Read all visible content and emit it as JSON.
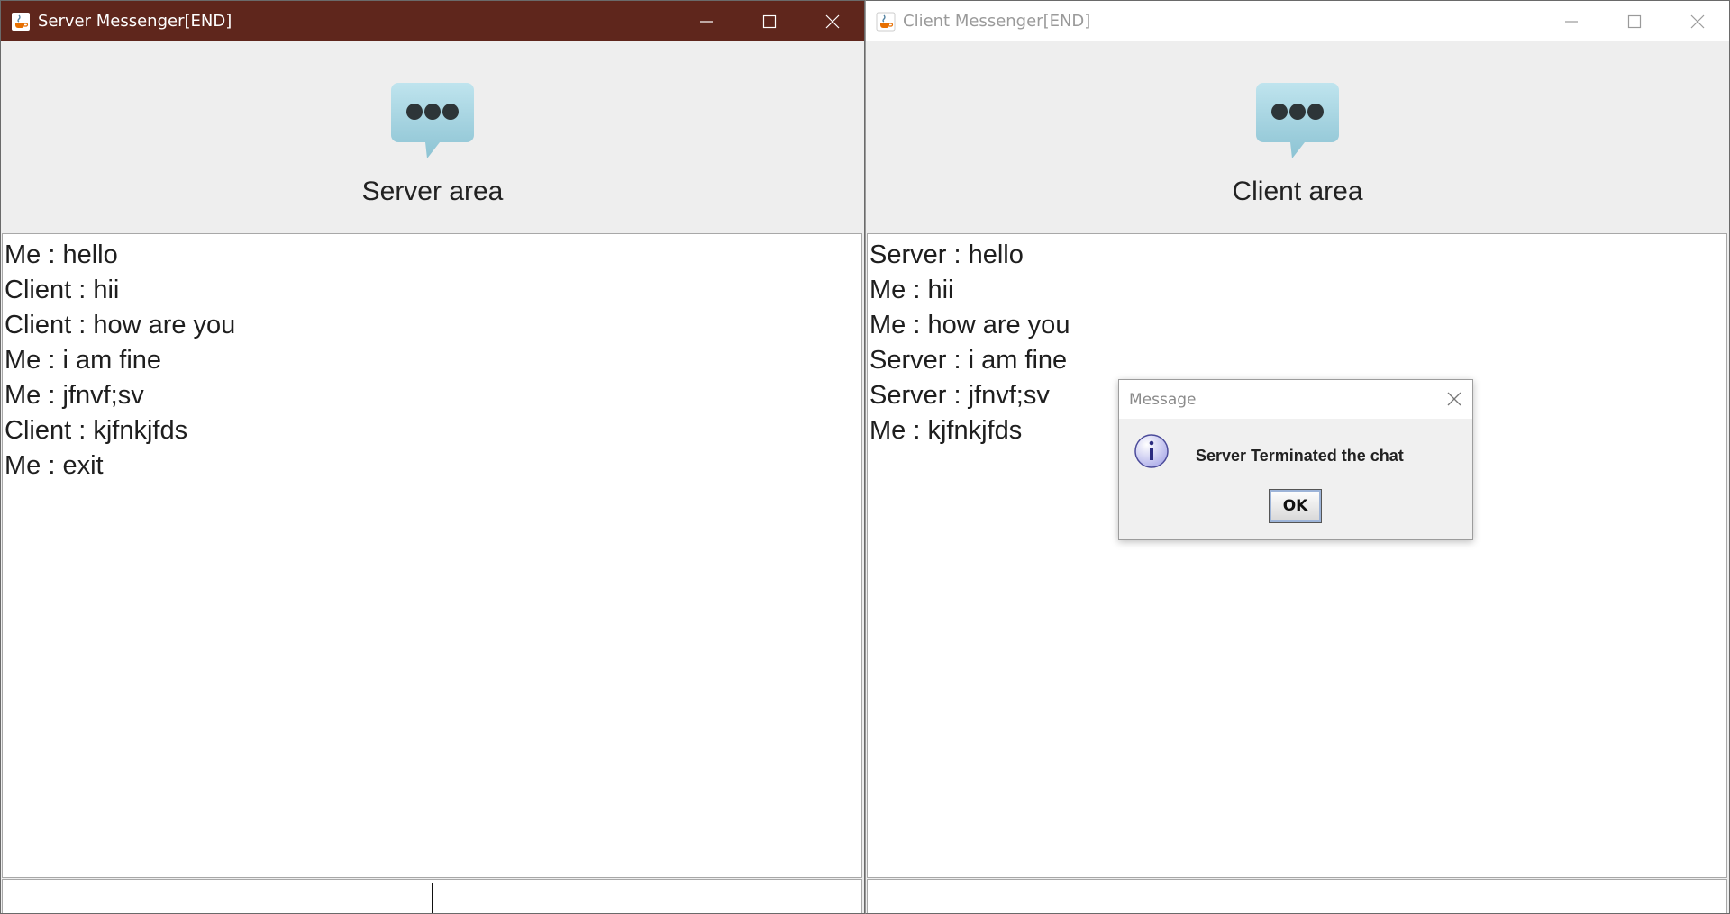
{
  "server_window": {
    "title": "Server Messenger[END]",
    "header_label": "Server area",
    "messages": [
      "Me : hello",
      "Client : hii",
      "Client : how are you",
      "Me : i am fine",
      "Me : jfnvf;sv",
      "Client : kjfnkjfds",
      "Me : exit"
    ],
    "input_value": ""
  },
  "client_window": {
    "title": "Client Messenger[END]",
    "header_label": "Client area",
    "messages": [
      "Server : hello",
      "Me : hii",
      "Me : how are you",
      "Server : i am fine",
      "Server : jfnvf;sv",
      "Me : kjfnkjfds"
    ],
    "input_value": ""
  },
  "dialog": {
    "title": "Message",
    "message": "Server Terminated the chat",
    "ok_label": "OK"
  },
  "icons": {
    "window_app": "java-coffee-icon",
    "header": "chat-bubble-icon",
    "dialog": "info-icon"
  },
  "colors": {
    "active_titlebar": "#5f261c",
    "inactive_titlebar": "#ffffff",
    "panel_bg": "#eeeeee",
    "bubble": "#9fd0df"
  }
}
